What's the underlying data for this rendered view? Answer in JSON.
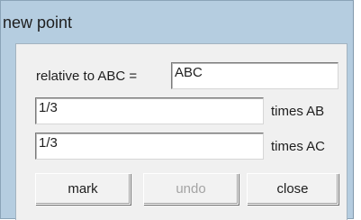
{
  "window": {
    "title": "new point"
  },
  "form": {
    "relative_label": "relative to ABC =",
    "relative_value": "ABC",
    "ab_value": "1/3",
    "ab_label": "times AB",
    "ac_value": "1/3",
    "ac_label": "times AC"
  },
  "buttons": {
    "mark": "mark",
    "undo": "undo",
    "close": "close"
  }
}
